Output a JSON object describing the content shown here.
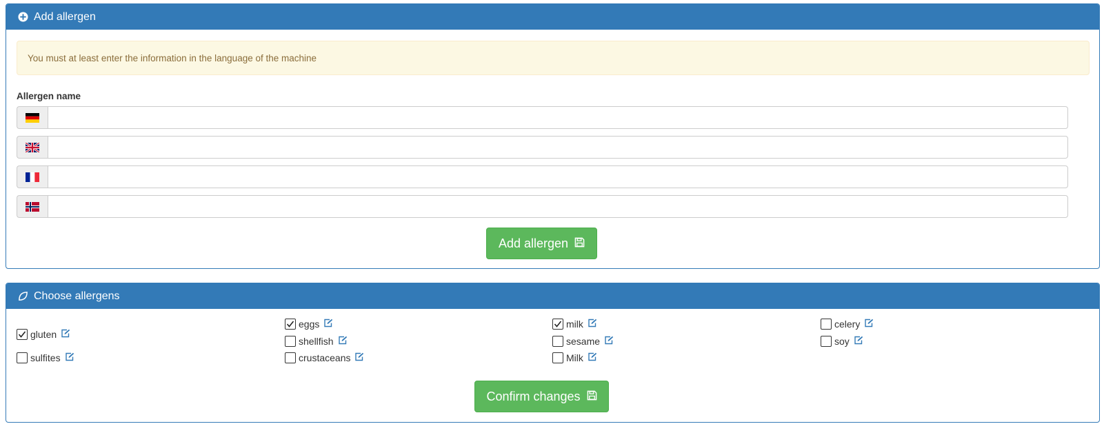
{
  "add_panel": {
    "title": "Add allergen",
    "title_icon": "plus-circle-icon",
    "alert_text": "You must at least enter the information in the language of the machine",
    "name_label": "Allergen name",
    "languages": [
      {
        "flag": "germany-flag-icon",
        "value": "",
        "placeholder": ""
      },
      {
        "flag": "uk-flag-icon",
        "value": "",
        "placeholder": ""
      },
      {
        "flag": "france-flag-icon",
        "value": "",
        "placeholder": ""
      },
      {
        "flag": "norway-flag-icon",
        "value": "",
        "placeholder": ""
      }
    ],
    "submit_label": "Add allergen",
    "submit_icon": "save-icon"
  },
  "choose_panel": {
    "title": "Choose allergens",
    "title_icon": "leaf-icon",
    "allergens": [
      {
        "label": "gluten",
        "checked": true
      },
      {
        "label": "sulfites",
        "checked": false
      },
      {
        "label": "eggs",
        "checked": true
      },
      {
        "label": "shellfish",
        "checked": false
      },
      {
        "label": "crustaceans",
        "checked": false
      },
      {
        "label": "milk",
        "checked": true
      },
      {
        "label": "sesame",
        "checked": false
      },
      {
        "label": "Milk",
        "checked": false
      },
      {
        "label": "celery",
        "checked": false
      },
      {
        "label": "soy",
        "checked": false
      }
    ],
    "confirm_label": "Confirm changes",
    "confirm_icon": "save-icon"
  },
  "colors": {
    "primary": "#337ab7",
    "success": "#5cb85c",
    "warning_bg": "#fcf8e3",
    "warning_text": "#8a6d3b"
  }
}
